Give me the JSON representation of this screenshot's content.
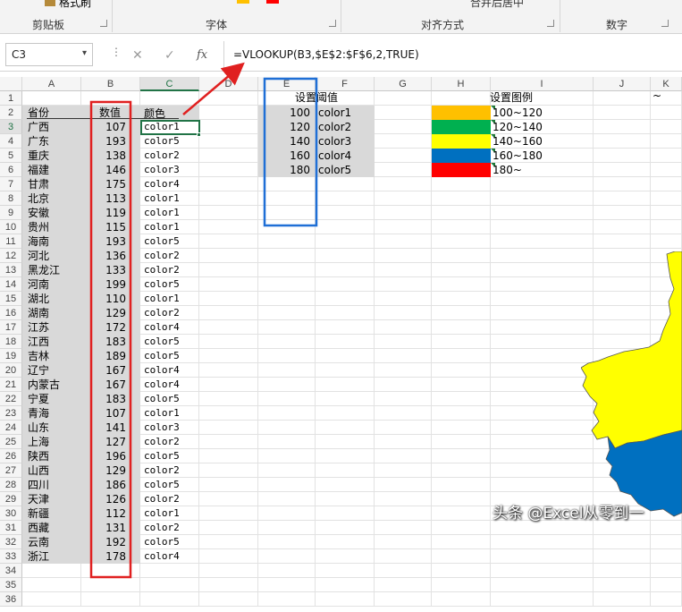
{
  "ribbon": {
    "format_painter": "格式刷",
    "groups": [
      "剪贴板",
      "字体",
      "对齐方式",
      "数字"
    ],
    "merge_fragment": "合并后居中"
  },
  "formula_bar": {
    "name_box": "C3",
    "formula": "=VLOOKUP(B3,$E$2:$F$6,2,TRUE)"
  },
  "columns": [
    "A",
    "B",
    "C",
    "D",
    "E",
    "F",
    "G",
    "H",
    "I",
    "J",
    "K"
  ],
  "rows": [
    "1",
    "2",
    "3",
    "4",
    "5",
    "6",
    "7",
    "8",
    "9",
    "10",
    "11",
    "12",
    "13",
    "14",
    "15",
    "16",
    "17",
    "18",
    "19",
    "20",
    "21",
    "22",
    "23",
    "24",
    "25",
    "26",
    "27",
    "28",
    "29",
    "30",
    "31",
    "32",
    "33",
    "34",
    "35",
    "36"
  ],
  "headers": {
    "province": "省份",
    "value": "数值",
    "color": "颜色",
    "threshold": "设置阈值",
    "legend": "设置图例"
  },
  "data_rows": [
    {
      "province": "广西",
      "value": "107",
      "color": "color1"
    },
    {
      "province": "广东",
      "value": "193",
      "color": "color5"
    },
    {
      "province": "重庆",
      "value": "138",
      "color": "color2"
    },
    {
      "province": "福建",
      "value": "146",
      "color": "color3"
    },
    {
      "province": "甘肃",
      "value": "175",
      "color": "color4"
    },
    {
      "province": "北京",
      "value": "113",
      "color": "color1"
    },
    {
      "province": "安徽",
      "value": "119",
      "color": "color1"
    },
    {
      "province": "贵州",
      "value": "115",
      "color": "color1"
    },
    {
      "province": "海南",
      "value": "193",
      "color": "color5"
    },
    {
      "province": "河北",
      "value": "136",
      "color": "color2"
    },
    {
      "province": "黑龙江",
      "value": "133",
      "color": "color2"
    },
    {
      "province": "河南",
      "value": "199",
      "color": "color5"
    },
    {
      "province": "湖北",
      "value": "110",
      "color": "color1"
    },
    {
      "province": "湖南",
      "value": "129",
      "color": "color2"
    },
    {
      "province": "江苏",
      "value": "172",
      "color": "color4"
    },
    {
      "province": "江西",
      "value": "183",
      "color": "color5"
    },
    {
      "province": "吉林",
      "value": "189",
      "color": "color5"
    },
    {
      "province": "辽宁",
      "value": "167",
      "color": "color4"
    },
    {
      "province": "内蒙古",
      "value": "167",
      "color": "color4"
    },
    {
      "province": "宁夏",
      "value": "183",
      "color": "color5"
    },
    {
      "province": "青海",
      "value": "107",
      "color": "color1"
    },
    {
      "province": "山东",
      "value": "141",
      "color": "color3"
    },
    {
      "province": "上海",
      "value": "127",
      "color": "color2"
    },
    {
      "province": "陕西",
      "value": "196",
      "color": "color5"
    },
    {
      "province": "山西",
      "value": "129",
      "color": "color2"
    },
    {
      "province": "四川",
      "value": "186",
      "color": "color5"
    },
    {
      "province": "天津",
      "value": "126",
      "color": "color2"
    },
    {
      "province": "新疆",
      "value": "112",
      "color": "color1"
    },
    {
      "province": "西藏",
      "value": "131",
      "color": "color2"
    },
    {
      "province": "云南",
      "value": "192",
      "color": "color5"
    },
    {
      "province": "浙江",
      "value": "178",
      "color": "color4"
    }
  ],
  "thresholds": [
    {
      "value": "100",
      "label": "color1"
    },
    {
      "value": "120",
      "label": "color2"
    },
    {
      "value": "140",
      "label": "color3"
    },
    {
      "value": "160",
      "label": "color4"
    },
    {
      "value": "180",
      "label": "color5"
    }
  ],
  "legend": [
    {
      "color": "#FFC000",
      "range": "100~120"
    },
    {
      "color": "#00B050",
      "range": "120~140"
    },
    {
      "color": "#FFFF00",
      "range": "140~160"
    },
    {
      "color": "#0070C0",
      "range": "160~180"
    },
    {
      "color": "#FF0000",
      "range": "180~"
    }
  ],
  "k1_mark": "~",
  "map_colors": {
    "north": "#FFFF00",
    "south": "#0070C0",
    "border": "#555555"
  },
  "annotation_colors": {
    "red_box": "#E02020",
    "blue_box": "#1F6FD6",
    "arrow": "#E02020"
  },
  "watermark": "头条 @Excel从零到一"
}
